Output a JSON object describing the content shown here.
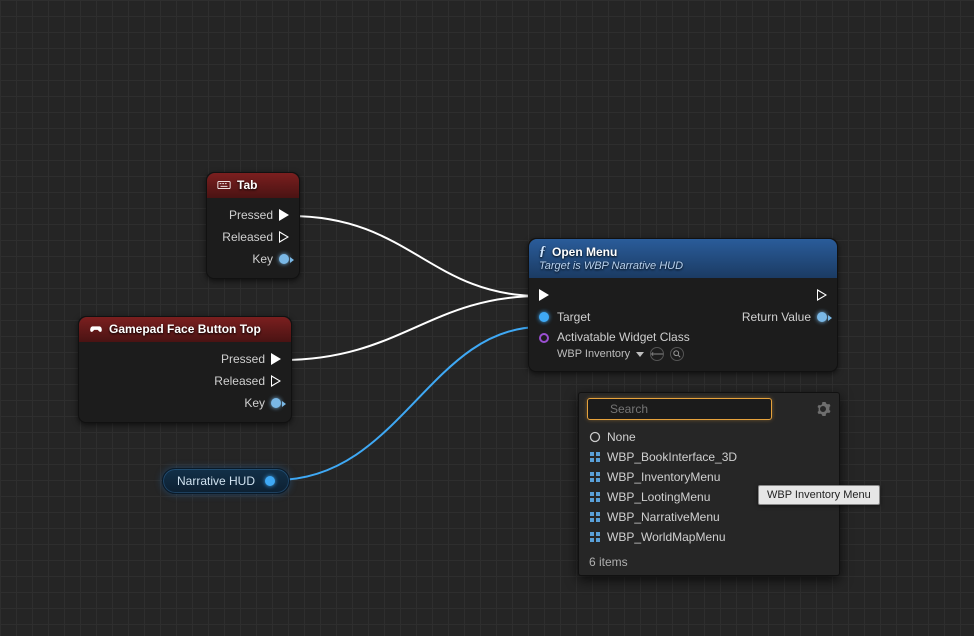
{
  "nodes": {
    "tab": {
      "title": "Tab",
      "pins": {
        "pressed": "Pressed",
        "released": "Released",
        "key": "Key"
      }
    },
    "gamepad": {
      "title": "Gamepad Face Button Top",
      "pins": {
        "pressed": "Pressed",
        "released": "Released",
        "key": "Key"
      }
    },
    "hud_var": {
      "label": "Narrative HUD"
    },
    "openmenu": {
      "title": "Open Menu",
      "subtitle": "Target is WBP Narrative HUD",
      "pins": {
        "target": "Target",
        "return": "Return Value",
        "widgetclass_label": "Activatable Widget Class",
        "widgetclass_value": "WBP Inventory"
      }
    }
  },
  "picker": {
    "search_placeholder": "Search",
    "items": [
      {
        "label": "None",
        "type": "none"
      },
      {
        "label": "WBP_BookInterface_3D",
        "type": "bp"
      },
      {
        "label": "WBP_InventoryMenu",
        "type": "bp"
      },
      {
        "label": "WBP_LootingMenu",
        "type": "bp"
      },
      {
        "label": "WBP_NarrativeMenu",
        "type": "bp"
      },
      {
        "label": "WBP_WorldMapMenu",
        "type": "bp"
      }
    ],
    "footer": "6 items"
  },
  "tooltip": "WBP Inventory Menu"
}
